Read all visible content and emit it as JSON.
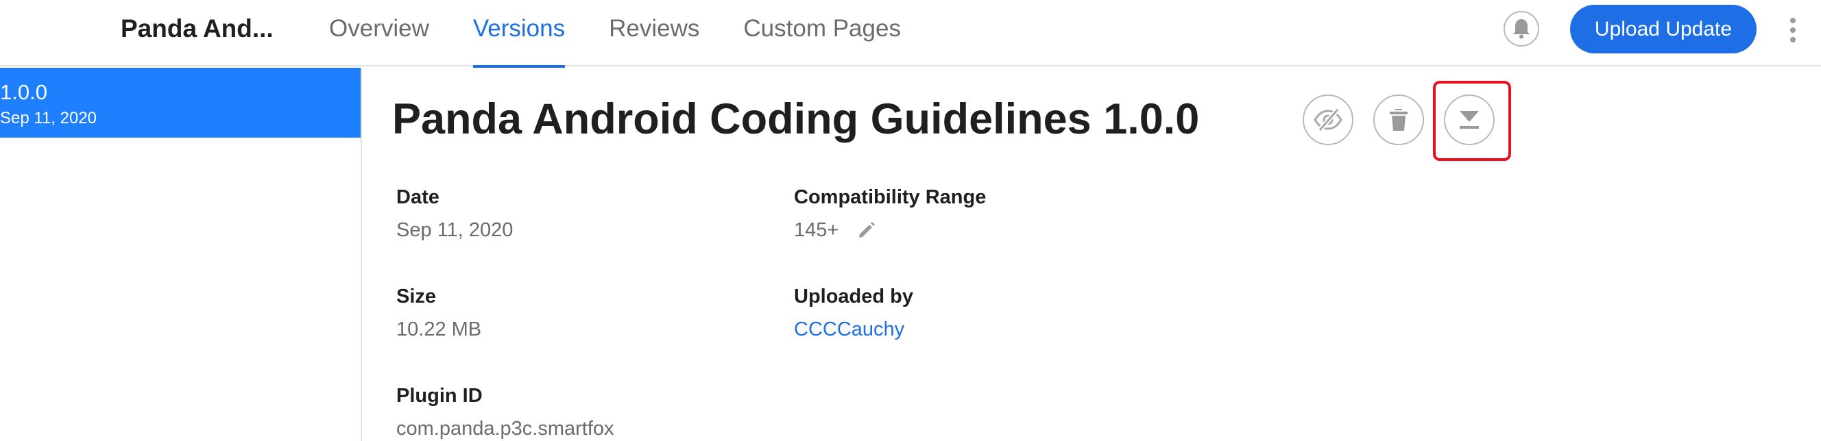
{
  "header": {
    "app_title": "Panda And...",
    "tabs": [
      {
        "label": "Overview",
        "active": false
      },
      {
        "label": "Versions",
        "active": true
      },
      {
        "label": "Reviews",
        "active": false
      },
      {
        "label": "Custom Pages",
        "active": false
      }
    ],
    "upload_label": "Upload Update",
    "icons": {
      "notifications": "bell-icon",
      "more": "more-vertical-icon"
    }
  },
  "sidebar": {
    "versions": [
      {
        "version": "1.0.0",
        "date": "Sep 11, 2020",
        "selected": true
      }
    ]
  },
  "main": {
    "title": "Panda Android Coding Guidelines 1.0.0",
    "actions": [
      {
        "name": "hide",
        "icon": "eye-off-icon"
      },
      {
        "name": "delete",
        "icon": "trash-icon"
      },
      {
        "name": "download",
        "icon": "download-icon",
        "highlighted": true
      }
    ],
    "fields": {
      "date": {
        "label": "Date",
        "value": "Sep 11, 2020"
      },
      "compatibility": {
        "label": "Compatibility Range",
        "value": "145+"
      },
      "size": {
        "label": "Size",
        "value": "10.22 MB"
      },
      "uploaded_by": {
        "label": "Uploaded by",
        "value": "CCCCauchy"
      },
      "plugin_id": {
        "label": "Plugin ID",
        "value": "com.panda.p3c.smartfox"
      }
    }
  },
  "colors": {
    "accent": "#1e6fe6",
    "selected_bg": "#1e80ff",
    "highlight": "#e8101e",
    "muted_text": "#6b6b6b"
  }
}
